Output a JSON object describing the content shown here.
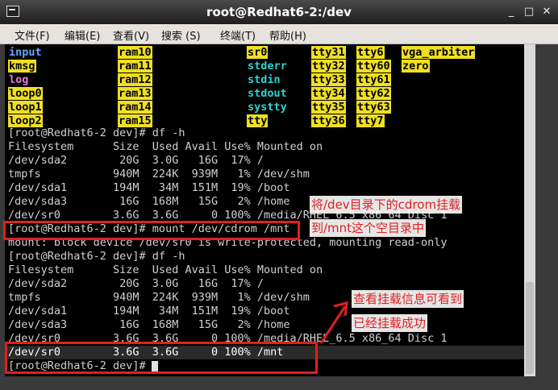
{
  "window": {
    "title": "root@Redhat6-2:/dev",
    "controls": [
      "_",
      "□",
      "✕"
    ]
  },
  "menu": [
    "文件(F)",
    "编辑(E)",
    "查看(V)",
    "搜索 (S)",
    "终端(T)",
    "帮助(H)"
  ],
  "ls_listing": {
    "col1": [
      {
        "text": "input",
        "style": "blue"
      },
      {
        "text": "kmsg",
        "style": "hl"
      },
      {
        "text": "log",
        "style": "pink"
      },
      {
        "text": "loop0",
        "style": "hl"
      },
      {
        "text": "loop1",
        "style": "hl"
      },
      {
        "text": "loop2",
        "style": "hl"
      }
    ],
    "col2": [
      "ram10",
      "ram11",
      "ram12",
      "ram13",
      "ram14",
      "ram15"
    ],
    "col3": [
      {
        "text": "sr0",
        "style": "hl"
      },
      {
        "text": "stderr",
        "style": "cyan"
      },
      {
        "text": "stdin",
        "style": "cyan"
      },
      {
        "text": "stdout",
        "style": "cyan"
      },
      {
        "text": "systty",
        "style": "cyan"
      },
      {
        "text": "tty",
        "style": "hl"
      }
    ],
    "col4": [
      "tty31",
      "tty32",
      "tty33",
      "tty34",
      "tty35",
      "tty36"
    ],
    "col5": [
      "tty6",
      "tty60",
      "tty61",
      "tty62",
      "tty63",
      "tty7"
    ],
    "col6": [
      "vga_arbiter",
      "zero"
    ]
  },
  "terminal_lines": [
    "[root@Redhat6-2 dev]# df -h",
    "Filesystem      Size  Used Avail Use% Mounted on",
    "/dev/sda2        20G  3.0G   16G  17% /",
    "tmpfs           940M  224K  939M   1% /dev/shm",
    "/dev/sda1       194M   34M  151M  19% /boot",
    "/dev/sda3        16G  168M   15G   2% /home",
    "/dev/sr0        3.6G  3.6G     0 100% /media/RHEL_6.5 x86_64 Disc 1",
    "[root@Redhat6-2 dev]# mount /dev/cdrom /mnt",
    "mount: block device /dev/sr0 is write-protected, mounting read-only",
    "[root@Redhat6-2 dev]# df -h",
    "Filesystem      Size  Used Avail Use% Mounted on",
    "/dev/sda2        20G  3.0G   16G  17% /",
    "tmpfs           940M  224K  939M   1% /dev/shm",
    "/dev/sda1       194M   34M  151M  19% /boot",
    "/dev/sda3        16G  168M   15G   2% /home",
    "/dev/sr0        3.6G  3.6G     0 100% /media/RHEL_6.5 x86_64 Disc 1",
    "/dev/sr0        3.6G  3.6G     0 100% /mnt",
    "[root@Redhat6-2 dev]# "
  ],
  "annotations": {
    "mount_note_line1": "将/dev目录下的cdrom挂载",
    "mount_note_line2": "到/mnt这个空目录中",
    "check_note_line1": "查看挂载信息可看到",
    "check_note_line2": "已经挂载成功"
  },
  "colors": {
    "highlight": "#f0e020",
    "annotation_red": "#e02020",
    "terminal_bg": "#000000"
  }
}
